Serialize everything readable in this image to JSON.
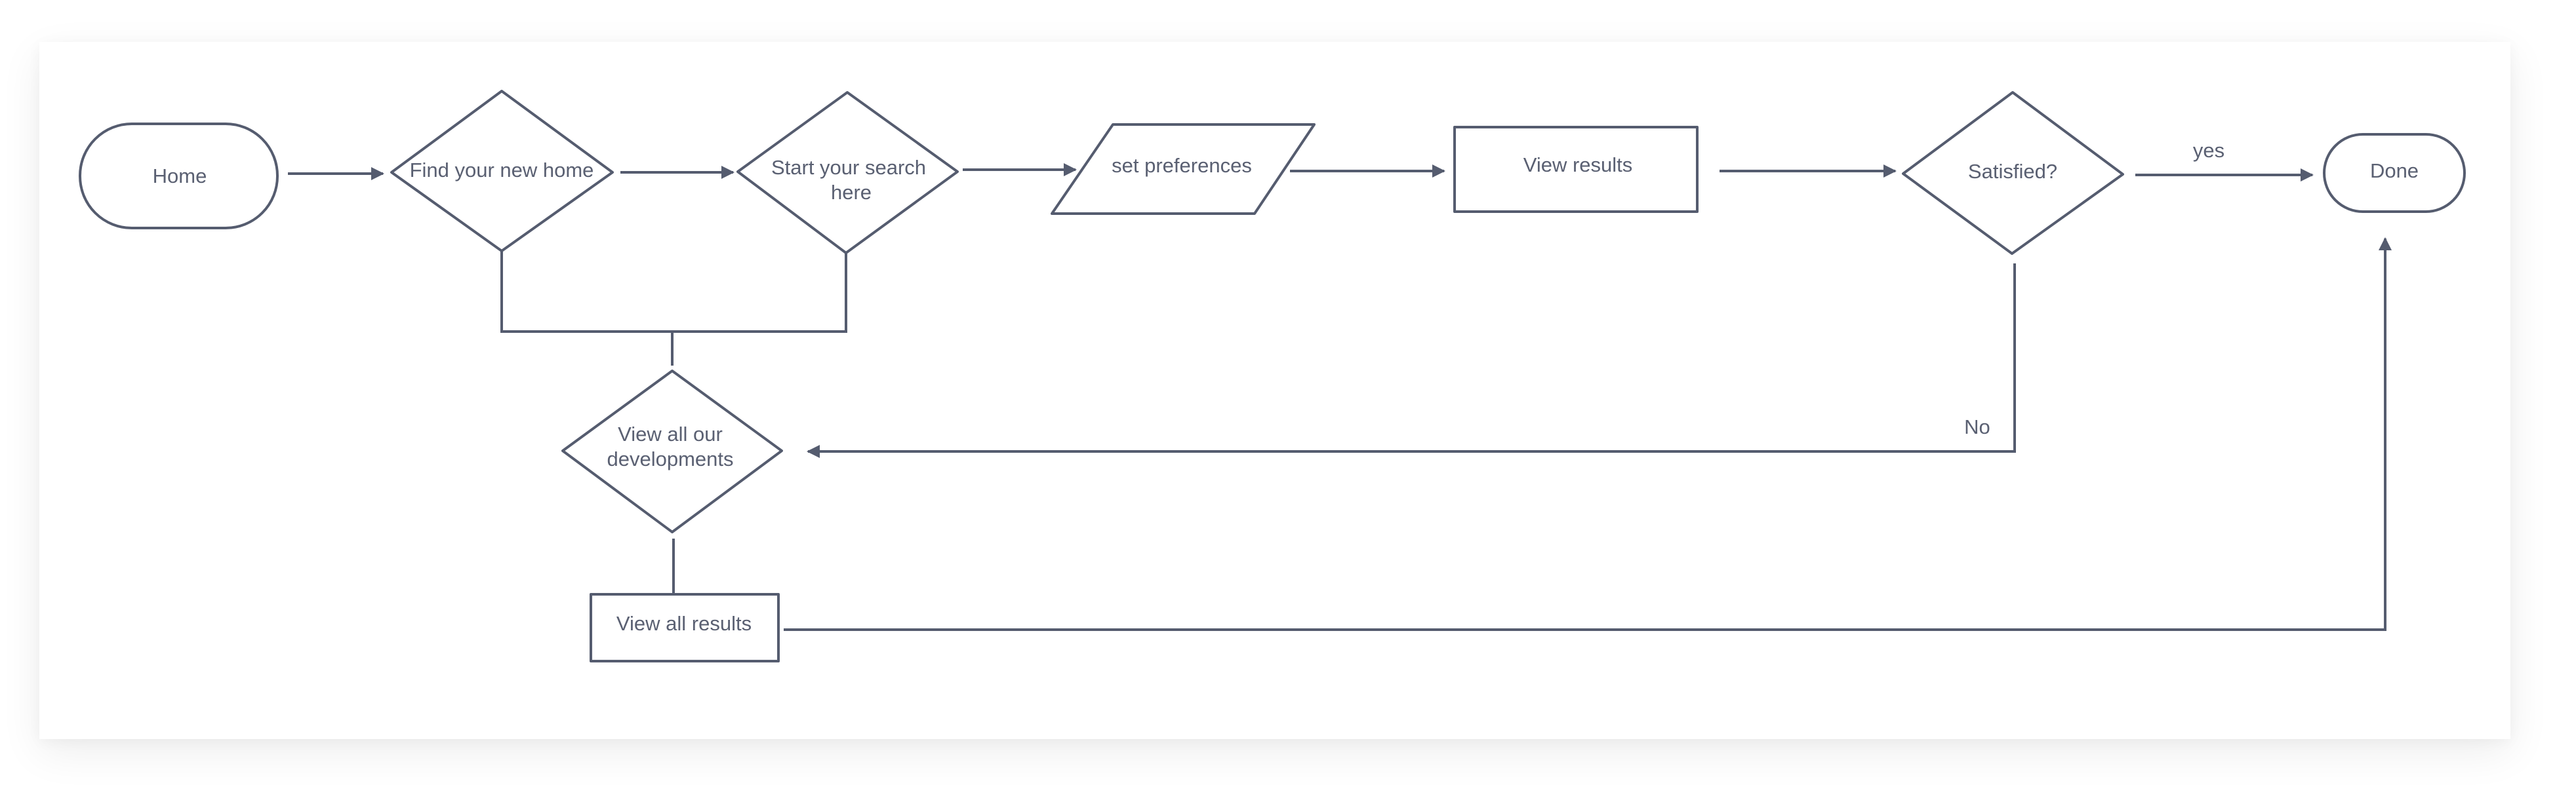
{
  "diagram": {
    "type": "flowchart",
    "stroke_color": "#555c6f",
    "text_color": "#5a6072",
    "background_color": "#ffffff",
    "nodes": [
      {
        "id": "home",
        "shape": "terminator",
        "lines": [
          "Home"
        ]
      },
      {
        "id": "find",
        "shape": "decision",
        "lines": [
          "Find your new home"
        ]
      },
      {
        "id": "start",
        "shape": "decision",
        "lines": [
          "Start your search",
          "here"
        ]
      },
      {
        "id": "prefs",
        "shape": "input-output",
        "lines": [
          "set preferences"
        ]
      },
      {
        "id": "results",
        "shape": "process",
        "lines": [
          "View results"
        ]
      },
      {
        "id": "satisfied",
        "shape": "decision",
        "lines": [
          "Satisfied?"
        ]
      },
      {
        "id": "done",
        "shape": "terminator",
        "lines": [
          "Done"
        ]
      },
      {
        "id": "devs",
        "shape": "decision",
        "lines": [
          "View all our",
          "developments"
        ]
      },
      {
        "id": "allresults",
        "shape": "process",
        "lines": [
          "View all results"
        ]
      }
    ],
    "edges": [
      {
        "from": "home",
        "to": "find",
        "label": ""
      },
      {
        "from": "find",
        "to": "start",
        "label": ""
      },
      {
        "from": "start",
        "to": "prefs",
        "label": ""
      },
      {
        "from": "prefs",
        "to": "results",
        "label": ""
      },
      {
        "from": "results",
        "to": "satisfied",
        "label": ""
      },
      {
        "from": "satisfied",
        "to": "done",
        "label": "yes"
      },
      {
        "from": "satisfied",
        "to": "devs",
        "label": "No"
      },
      {
        "from": "find",
        "to": "devs",
        "label": ""
      },
      {
        "from": "start",
        "to": "devs",
        "label": ""
      },
      {
        "from": "devs",
        "to": "allresults",
        "label": ""
      },
      {
        "from": "allresults",
        "to": "done",
        "label": ""
      }
    ]
  }
}
